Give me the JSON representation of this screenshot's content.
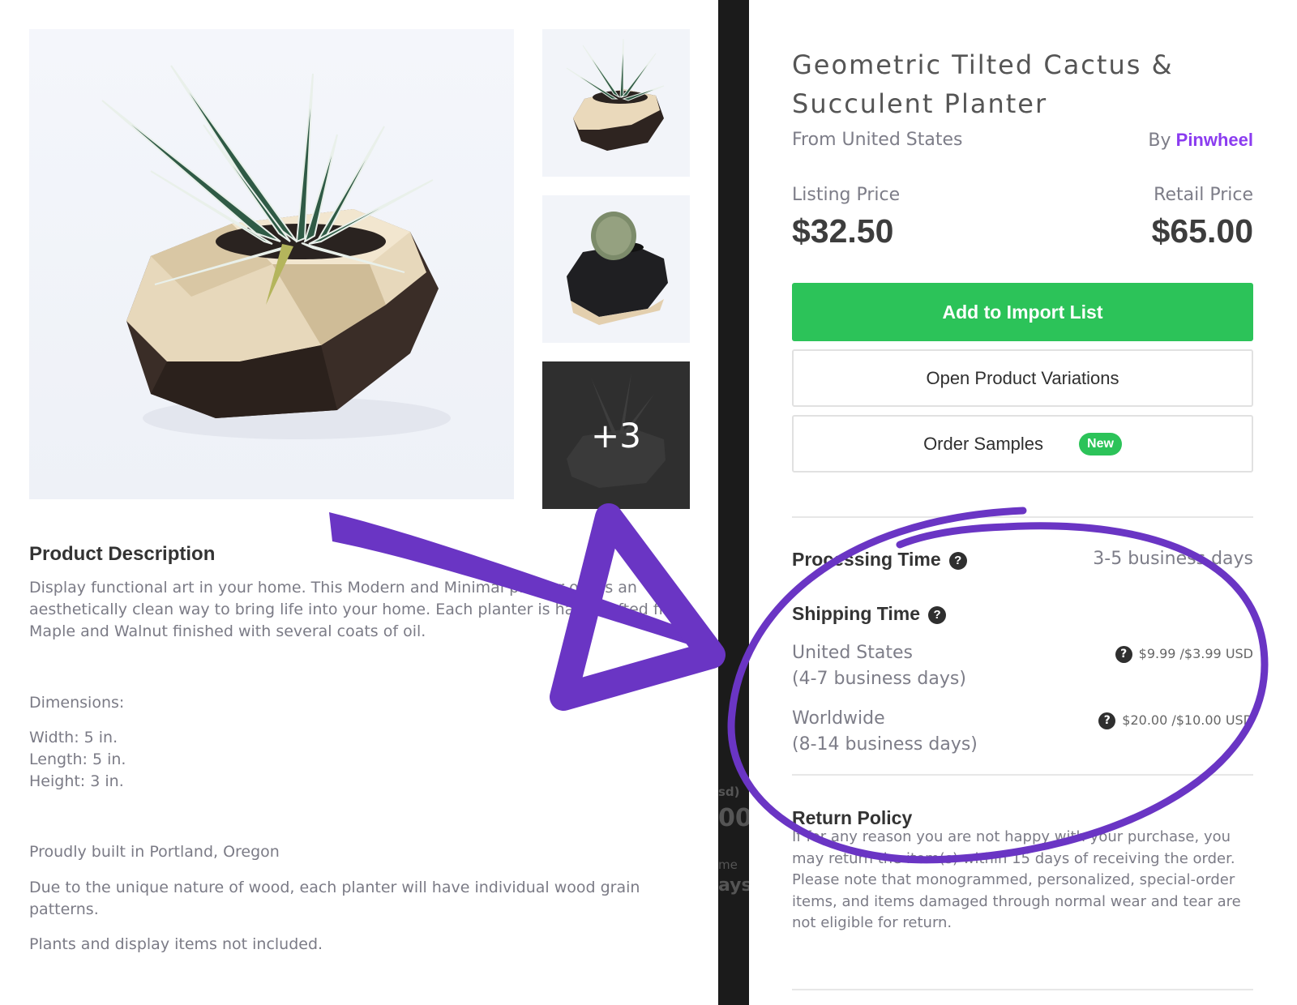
{
  "product": {
    "title": "Geometric Tilted Cactus & Succulent Planter",
    "origin": "From United States",
    "seller_prefix": "By",
    "seller": "Pinwheel",
    "listing_price_label": "Listing Price",
    "listing_price": "$32.50",
    "retail_price_label": "Retail Price",
    "retail_price": "$65.00"
  },
  "gallery": {
    "more_count": "+3"
  },
  "actions": {
    "add_to_import": "Add to Import List",
    "open_variations": "Open Product Variations",
    "order_samples": "Order Samples",
    "new_badge": "New"
  },
  "processing": {
    "label": "Processing Time",
    "value": "3-5 business days"
  },
  "shipping": {
    "label": "Shipping Time",
    "rows": [
      {
        "region": "United States",
        "days": "(4-7 business days)",
        "cost": "$9.99 /$3.99 USD"
      },
      {
        "region": "Worldwide",
        "days": "(8-14 business days)",
        "cost": "$20.00 /$10.00 USD"
      }
    ]
  },
  "return_policy": {
    "label": "Return Policy",
    "text": "If for any reason you are not happy with your purchase, you may return the item(s) within 15 days of receiving the order. Please note that monogrammed, personalized, special-order items, and items damaged through normal wear and tear are not eligible for return."
  },
  "description": {
    "title": "Product Description",
    "intro": "Display functional art in your home. This Modern and Minimal planter offers an aesthetically clean way to bring life into your home. Each planter is handcrafted from Maple and Walnut finished with several coats of oil.",
    "dimensions_label": "Dimensions:",
    "width": "Width: 5 in.",
    "length": "Length: 5 in.",
    "height": "Height: 3 in.",
    "origin_note": "Proudly built in Portland, Oregon",
    "wood_note": "Due to the unique nature of wood, each planter will have individual wood grain patterns.",
    "plants_note": "Plants and display items not included."
  },
  "background_fragments": {
    "frag1": "sd)",
    "frag2": "00",
    "frag3": "me",
    "frag4": "ays"
  },
  "colors": {
    "accent_green": "#2cc359",
    "seller_purple": "#8b3cf0",
    "annotation_purple": "#6a35c4"
  }
}
